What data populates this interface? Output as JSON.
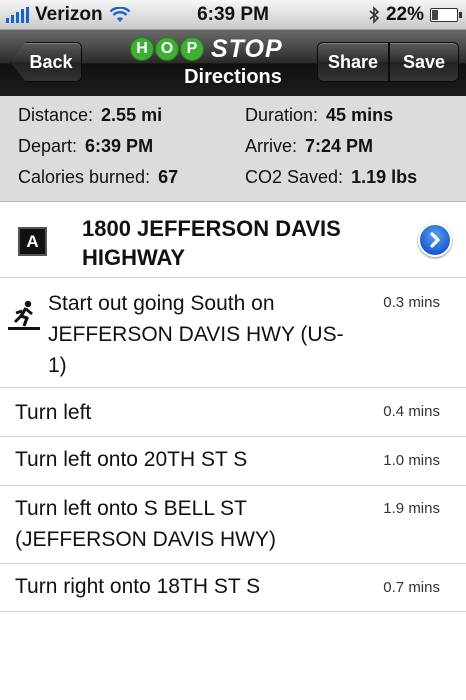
{
  "status": {
    "carrier": "Verizon",
    "time": "6:39 PM",
    "battery": "22%",
    "battery_level": 0.22
  },
  "nav": {
    "back_label": "Back",
    "logo_hop": [
      "H",
      "O",
      "P"
    ],
    "logo_stop": "STOP",
    "title": "Directions",
    "share_label": "Share",
    "save_label": "Save"
  },
  "summary": {
    "distance_label": "Distance:",
    "distance_value": "2.55 mi",
    "duration_label": "Duration:",
    "duration_value": "45 mins",
    "depart_label": "Depart:",
    "depart_value": "6:39 PM",
    "arrive_label": "Arrive:",
    "arrive_value": "7:24 PM",
    "calories_label": "Calories burned:",
    "calories_value": "67",
    "co2_label": "CO2 Saved:",
    "co2_value": "1.19 lbs"
  },
  "start": {
    "badge": "A",
    "title": "1800 JEFFERSON DAVIS HIGHWAY"
  },
  "steps": [
    {
      "text": "Start out going South on JEFFERSON DAVIS HWY (US-1)",
      "time": "0.3 mins",
      "icon": "walk-icon"
    },
    {
      "text": "Turn left",
      "time": "0.4 mins"
    },
    {
      "text": "Turn left onto 20TH ST S",
      "time": "1.0 mins"
    },
    {
      "text": "Turn left onto S BELL ST (JEFFERSON DAVIS HWY)",
      "time": "1.9 mins"
    },
    {
      "text": "Turn right onto 18TH ST S",
      "time": "0.7 mins"
    }
  ]
}
